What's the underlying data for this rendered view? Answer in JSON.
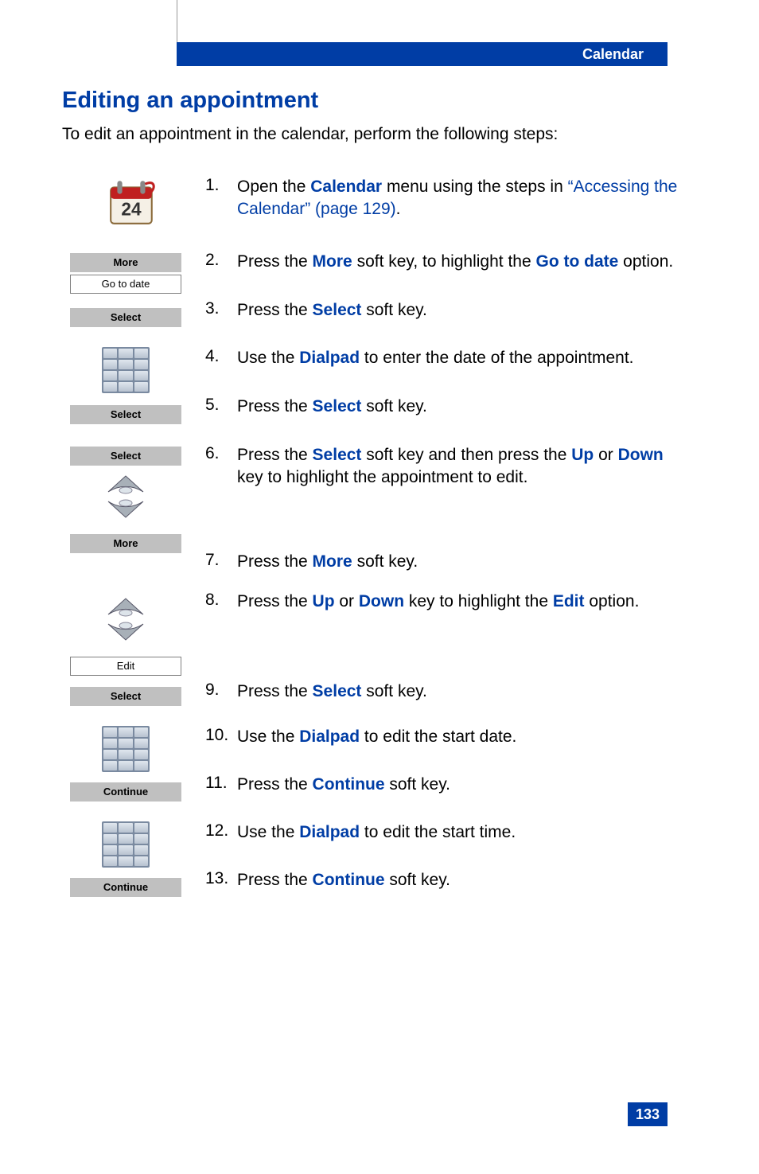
{
  "header": {
    "section": "Calendar"
  },
  "title": "Editing an appointment",
  "intro": "To edit an appointment in the calendar, perform the following steps:",
  "softkeys": {
    "more": "More",
    "go_to_date": "Go to date",
    "select": "Select",
    "edit": "Edit",
    "continue": "Continue"
  },
  "steps": {
    "s1": {
      "n": "1.",
      "pre": "Open the ",
      "k1": "Calendar",
      "mid": " menu using the steps in ",
      "link": "“Accessing the Calendar” (page 129)",
      "post": "."
    },
    "s2": {
      "n": "2.",
      "pre": "Press the ",
      "k1": "More",
      "mid": " soft key, to highlight the ",
      "k2": "Go to date",
      "post": " option."
    },
    "s3": {
      "n": "3.",
      "pre": "Press the ",
      "k1": "Select",
      "post": " soft key."
    },
    "s4": {
      "n": "4.",
      "pre": "Use the ",
      "k1": "Dialpad",
      "post": " to enter the date of the appointment."
    },
    "s5": {
      "n": "5.",
      "pre": "Press the ",
      "k1": "Select",
      "post": " soft key."
    },
    "s6": {
      "n": "6.",
      "pre": "Press the ",
      "k1": "Select",
      "mid": " soft key and then press the ",
      "k2": "Up",
      "mid2": " or ",
      "k3": "Down",
      "post": " key to highlight the appointment to edit."
    },
    "s7": {
      "n": "7.",
      "pre": "Press the ",
      "k1": "More",
      "post": " soft key."
    },
    "s8": {
      "n": "8.",
      "pre": "Press the ",
      "k1": "Up",
      "mid": " or ",
      "k2": "Down",
      "mid2": " key to highlight the ",
      "k3": "Edit",
      "post": " option."
    },
    "s9": {
      "n": "9.",
      "pre": "Press the ",
      "k1": "Select",
      "post": " soft key."
    },
    "s10": {
      "n": "10.",
      "pre": "Use the ",
      "k1": "Dialpad",
      "post": " to edit the start date."
    },
    "s11": {
      "n": "11.",
      "pre": "Press the ",
      "k1": "Continue",
      "post": " soft key."
    },
    "s12": {
      "n": "12.",
      "pre": "Use the ",
      "k1": "Dialpad",
      "post": " to edit the start time."
    },
    "s13": {
      "n": "13.",
      "pre": "Press the ",
      "k1": "Continue",
      "post": " soft key."
    }
  },
  "page_number": "133"
}
